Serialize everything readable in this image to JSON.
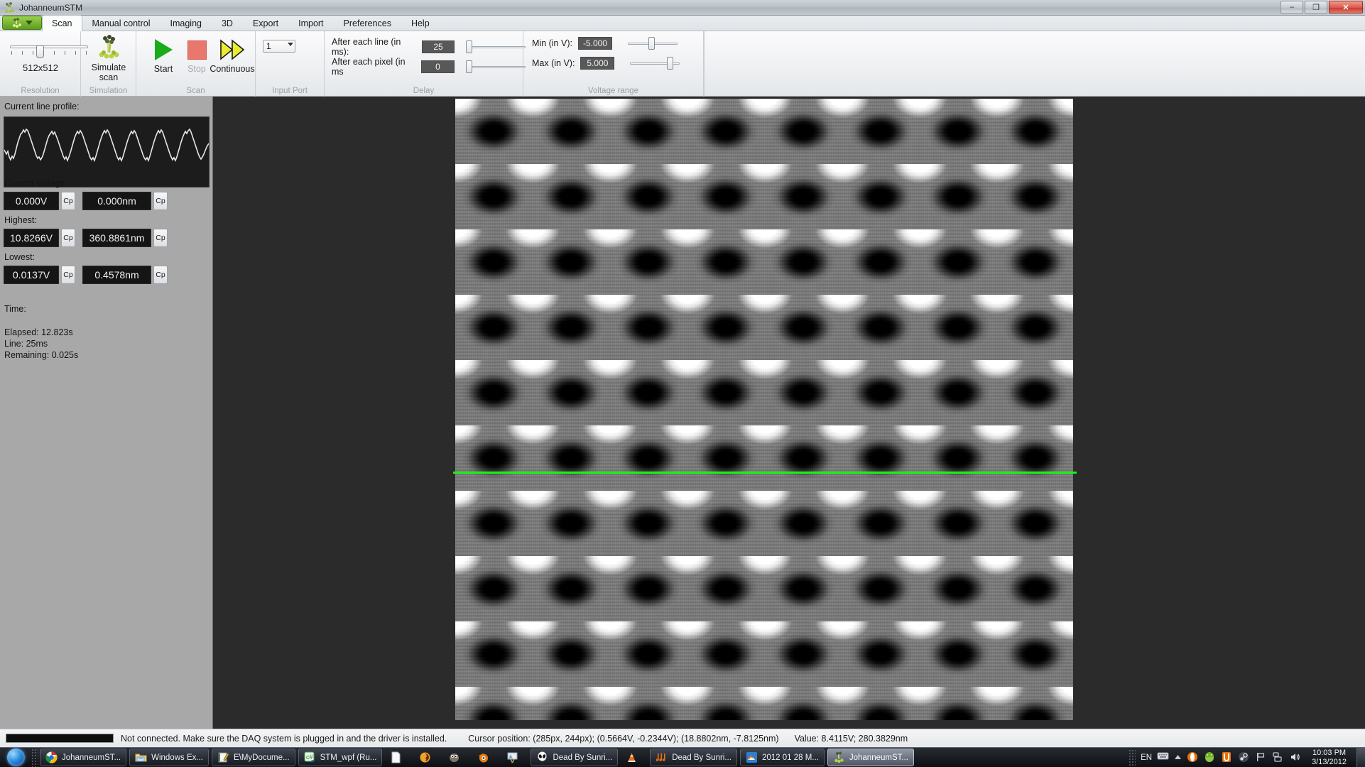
{
  "window": {
    "title": "JohanneumSTM",
    "icon": "molecule-icon",
    "buttons": {
      "minimize": "–",
      "maximize": "❐",
      "close": "✕"
    }
  },
  "ribbon": {
    "app_button_label": "app-menu",
    "tabs": [
      {
        "label": "Scan",
        "active": true
      },
      {
        "label": "Manual control",
        "active": false
      },
      {
        "label": "Imaging",
        "active": false
      },
      {
        "label": "3D",
        "active": false
      },
      {
        "label": "Export",
        "active": false
      },
      {
        "label": "Import",
        "active": false
      },
      {
        "label": "Preferences",
        "active": false
      },
      {
        "label": "Help",
        "active": false
      }
    ],
    "groups": {
      "resolution": {
        "label": "Resolution",
        "value": "512x512",
        "tick_count": 8,
        "thumb_index": 3
      },
      "simulation": {
        "label": "Simulation",
        "button": "Simulate scan"
      },
      "scan": {
        "label": "Scan",
        "start": "Start",
        "stop": "Stop",
        "stop_disabled": true,
        "continuous": "Continuous"
      },
      "input_port": {
        "label": "Input Port",
        "selected": "1"
      },
      "delay": {
        "label": "Delay",
        "after_line_label": "After each line (in ms):",
        "after_line_value": "25",
        "after_pixel_label": "After each pixel (in ms",
        "after_pixel_value": "0"
      },
      "voltage_range": {
        "label": "Voltage range",
        "min_label": "Min (in V):",
        "min_value": "-5.000",
        "max_label": "Max (in V):",
        "max_value": "5.000"
      }
    }
  },
  "sidebar": {
    "profile_title": "Current line profile:",
    "current_voltage_label": "Current voltage:",
    "current_voltage_v": "0.000V",
    "current_voltage_nm": "0.000nm",
    "highest_label": "Highest:",
    "highest_v": "10.8266V",
    "highest_nm": "360.8861nm",
    "lowest_label": "Lowest:",
    "lowest_v": "0.0137V",
    "lowest_nm": "0.4578nm",
    "copy_button": "Cp",
    "time_label": "Time:",
    "elapsed": "Elapsed: 12.823s",
    "line": "Line: 25ms",
    "remaining": "Remaining: 0.025s"
  },
  "canvas": {
    "name": "stm-scan-image",
    "line_marker_color": "#18f018"
  },
  "statusbar": {
    "connection": "Not connected. Make sure the DAQ system is plugged in and the driver is installed.",
    "cursor": "Cursor position: (285px, 244px);  (0.5664V, -0.2344V);  (18.8802nm, -7.8125nm)",
    "value": "Value: 8.4115V; 280.3829nm",
    "progress_percent": 0
  },
  "taskbar": {
    "start_label": "start-orb",
    "items": [
      {
        "label": "JohanneumST...",
        "icon": "chrome-icon",
        "active": false,
        "plain": false
      },
      {
        "label": "Windows Ex...",
        "icon": "explorer-folder-icon",
        "active": false,
        "plain": false
      },
      {
        "label": "E\\MyDocume...",
        "icon": "notepad-icon",
        "active": false,
        "plain": false
      },
      {
        "label": "STM_wpf (Ru...",
        "icon": "csharp-icon",
        "active": false,
        "plain": false
      },
      {
        "label": "",
        "icon": "document-icon",
        "active": false,
        "plain": true
      },
      {
        "label": "",
        "icon": "krita-icon",
        "active": false,
        "plain": true
      },
      {
        "label": "",
        "icon": "gimp-icon",
        "active": false,
        "plain": true
      },
      {
        "label": "",
        "icon": "blender-icon",
        "active": false,
        "plain": true
      },
      {
        "label": "",
        "icon": "paint-icon",
        "active": false,
        "plain": true
      },
      {
        "label": "Dead By Sunri...",
        "icon": "alien-icon",
        "active": false,
        "plain": false
      },
      {
        "label": "",
        "icon": "vlc-cone-icon",
        "active": false,
        "plain": true
      },
      {
        "label": "Dead By Sunri...",
        "icon": "music-notes-icon",
        "active": false,
        "plain": false
      },
      {
        "label": "2012 01 28 M...",
        "icon": "photo-viewer-icon",
        "active": false,
        "plain": false
      },
      {
        "label": "JohanneumST...",
        "icon": "molecule-icon",
        "active": true,
        "plain": false
      }
    ],
    "tray": {
      "language": "EN",
      "icons": [
        "keyboard-icon",
        "show-hidden-icon",
        "opera-icon",
        "android-icon",
        "ubuntu-icon",
        "steam-icon",
        "flag-icon",
        "network-icon",
        "volume-icon"
      ],
      "time": "10:03 PM",
      "date": "3/13/2012"
    }
  },
  "chart_data": {
    "type": "line",
    "title": "Current line profile",
    "xlabel": "",
    "ylabel": "",
    "periods": 8.5,
    "amplitude_v": 10.8266,
    "baseline_v": 0.0137,
    "series": [
      {
        "name": "line profile",
        "color": "#e8e8e8"
      }
    ]
  }
}
